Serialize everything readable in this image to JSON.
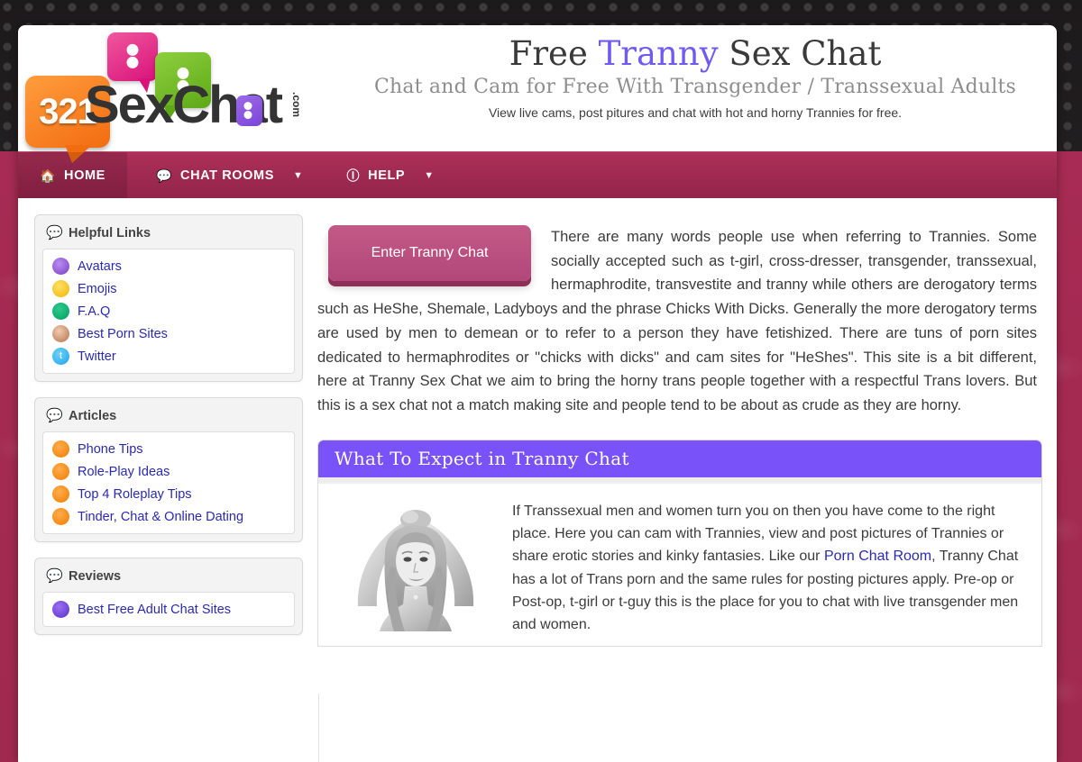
{
  "brand": {
    "logo_number": "321",
    "logo_word": "SexChat",
    "logo_tld": ".com"
  },
  "header": {
    "title_part1": "Free ",
    "title_highlight": "Tranny",
    "title_part2": " Sex Chat",
    "subtitle": "Chat and Cam for Free With Transgender / Transsexual Adults",
    "tagline": "View live cams, post pitures and chat with hot and horny Trannies for free."
  },
  "nav": {
    "items": [
      {
        "label": "Home",
        "icon": "home-icon",
        "caret": false,
        "active": true
      },
      {
        "label": "Chat Rooms",
        "icon": "chat-bubble-icon",
        "caret": true,
        "active": false
      },
      {
        "label": "Help",
        "icon": "info-circle-icon",
        "caret": true,
        "active": false
      }
    ],
    "caret_glyph": "▼"
  },
  "sidebar": {
    "panels": [
      {
        "title": "Helpful Links",
        "title_icon": "chat-bubbles-icon",
        "links": [
          {
            "label": "Avatars",
            "icon": "avatar-face-icon"
          },
          {
            "label": "Emojis",
            "icon": "emoji-wink-icon"
          },
          {
            "label": "F.A.Q",
            "icon": "question-bubble-icon"
          },
          {
            "label": "Best Porn Sites",
            "icon": "glasses-face-icon"
          },
          {
            "label": "Twitter",
            "icon": "twitter-bird-icon"
          }
        ]
      },
      {
        "title": "Articles",
        "title_icon": "chat-bubbles-icon",
        "links": [
          {
            "label": "Phone Tips",
            "icon": "open-book-icon"
          },
          {
            "label": "Role-Play Ideas",
            "icon": "open-book-icon"
          },
          {
            "label": "Top 4 Roleplay Tips",
            "icon": "open-book-icon"
          },
          {
            "label": "Tinder, Chat & Online Dating",
            "icon": "open-book-icon"
          }
        ]
      },
      {
        "title": "Reviews",
        "title_icon": "chat-bubbles-icon",
        "links": [
          {
            "label": "Best Free Adult Chat Sites",
            "icon": "thumbs-up-icon"
          }
        ]
      }
    ]
  },
  "main": {
    "cta_label": "Enter Tranny Chat",
    "intro_paragraph": "There are many words people use when referring to Trannies. Some socially accepted such as t-girl, cross-dresser, transgender, transsexual, hermaphrodite, transvestite and tranny while others are derogatory terms such as HeShe, Shemale, Ladyboys and the phrase Chicks With Dicks. Generally the more derogatory terms are used by men to demean or to refer to a person they have fetishized. There are tuns of porn sites dedicated to hermaphrodites or \"chicks with dicks\" and cam sites for \"HeShes\". This site is a bit different, here at Tranny Sex Chat we aim to bring the horny trans people together with a respectful Trans lovers. But this is a sex chat not a match making site and people tend to be about as crude as they are horny.",
    "expect": {
      "heading": "What To Expect in Tranny Chat",
      "photo_alt": "black-and-white photo of a long-haired person with arms raised above head",
      "text_before_link": "If Transsexual men and women turn you on then you have come to the right place. Here you can cam with Trannies, view and post pictures of Trannies or share erotic stories and kinky fantasies. Like our ",
      "link_label": "Porn Chat Room",
      "text_after_link": ", Tranny Chat has a lot of Trans porn and the same rules for posting pictures apply. Pre-op or Post-op, t-girl or t-guy this is the place for you to chat with live transgender men and women."
    }
  },
  "colors": {
    "nav_bar": "#a72b54",
    "accent_purple": "#7a52fa",
    "cta_pink": "#b2477a",
    "link_blue": "#2a2ab0",
    "title_highlight": "#6f5bf0"
  }
}
